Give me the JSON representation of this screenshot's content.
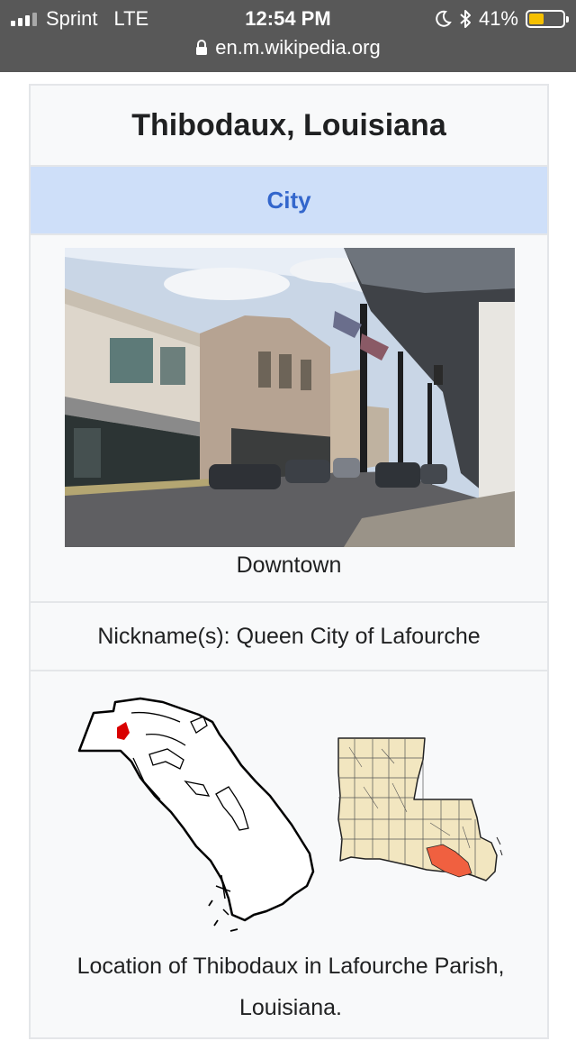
{
  "status_bar": {
    "carrier": "Sprint",
    "network": "LTE",
    "time": "12:54 PM",
    "battery": "41%",
    "battery_level": 0.41,
    "icons": [
      "signal-icon",
      "moon-icon",
      "bluetooth-icon",
      "battery-icon"
    ]
  },
  "url_bar": {
    "url": "en.m.wikipedia.org",
    "icon": "lock-icon"
  },
  "infobox": {
    "title": "Thibodaux, Louisiana",
    "type": "City",
    "photo_caption": "Downtown",
    "nickname_label": "Nickname(s):",
    "nickname_value": "Queen City of Lafourche",
    "map_caption": "Location of Thibodaux in Lafourche Parish, Louisiana."
  },
  "colors": {
    "status_bar_bg": "#585858",
    "type_header_bg": "#cedff9",
    "link_blue": "#3366cc",
    "battery_yellow": "#f5c000",
    "map_highlight": "#e03020",
    "parish_fill": "#f2e6c0",
    "parish_highlight": "#f06040"
  }
}
